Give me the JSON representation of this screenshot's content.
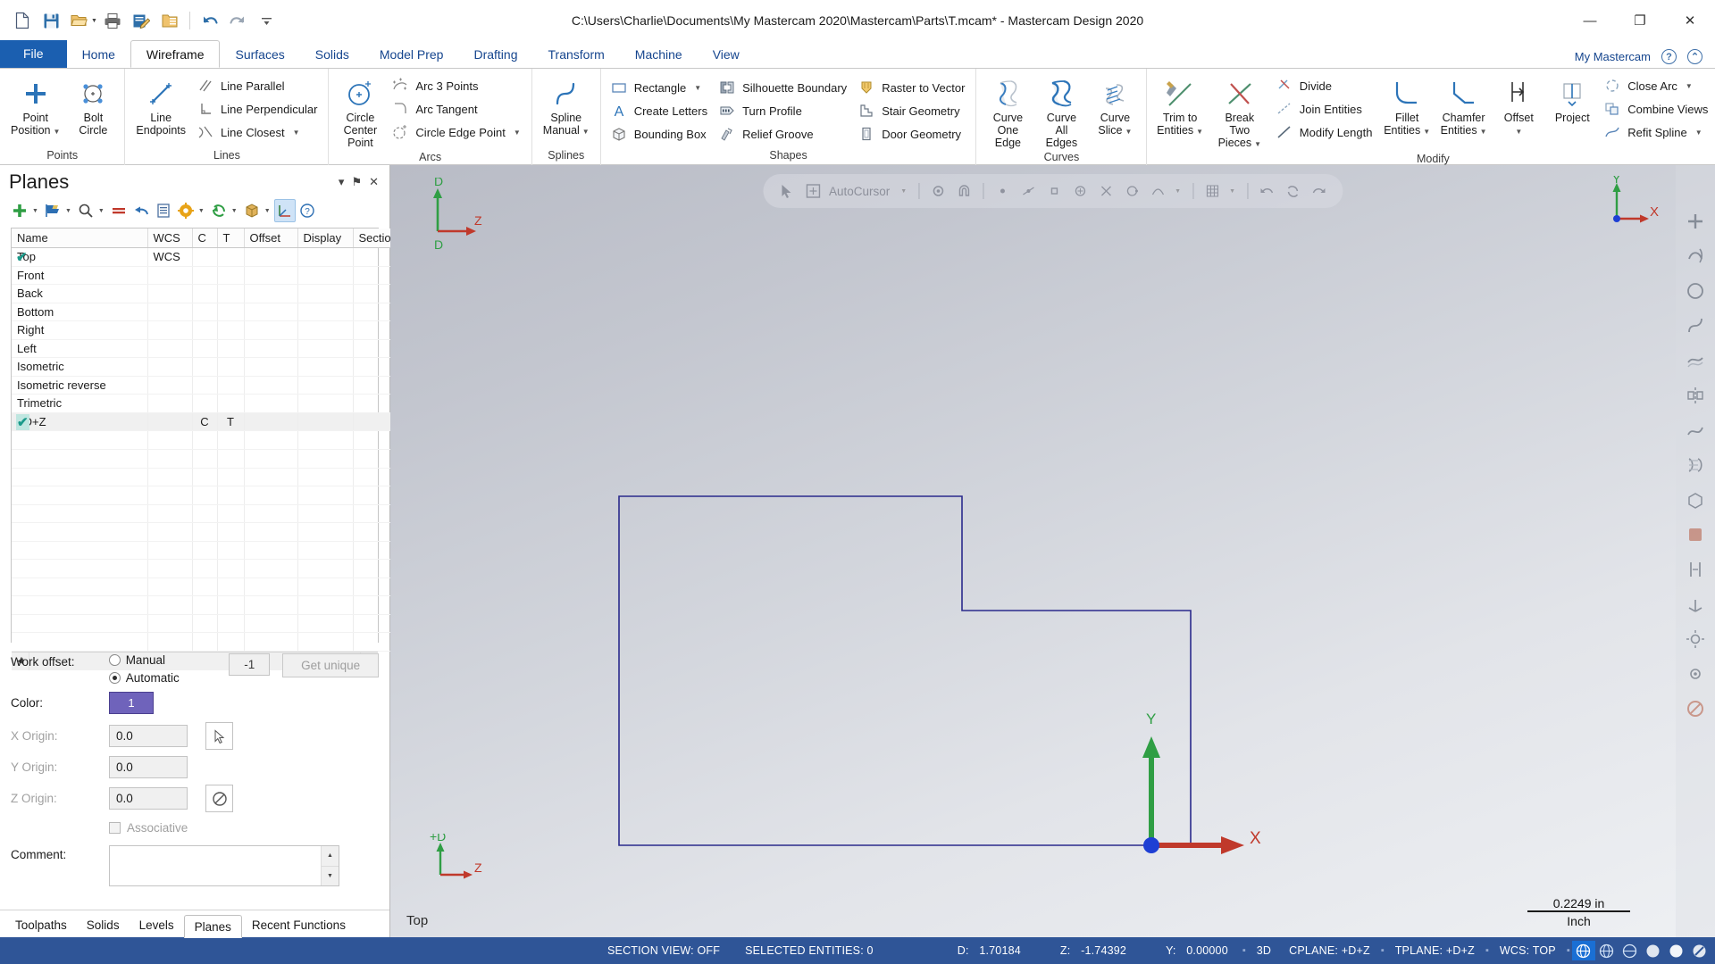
{
  "window": {
    "title": "C:\\Users\\Charlie\\Documents\\My Mastercam 2020\\Mastercam\\Parts\\T.mcam* - Mastercam Design 2020",
    "minimize": "—",
    "maximize": "❐",
    "close": "✕"
  },
  "quick_access": [
    {
      "name": "new-file-icon",
      "label": "New"
    },
    {
      "name": "save-icon",
      "label": "Save"
    },
    {
      "name": "open-folder-icon",
      "label": "Open"
    },
    {
      "name": "print-icon",
      "label": "Print"
    },
    {
      "name": "edit-file-icon",
      "label": "Edit"
    },
    {
      "name": "folder-list-icon",
      "label": "Browse"
    },
    {
      "name": "undo-icon",
      "label": "Undo"
    },
    {
      "name": "redo-icon",
      "label": "Redo"
    },
    {
      "name": "customize-qat-icon",
      "label": "Customize Quick Access Toolbar"
    }
  ],
  "tabs": [
    {
      "label": "File",
      "kind": "file"
    },
    {
      "label": "Home",
      "kind": "normal"
    },
    {
      "label": "Wireframe",
      "kind": "active"
    },
    {
      "label": "Surfaces",
      "kind": "normal"
    },
    {
      "label": "Solids",
      "kind": "normal"
    },
    {
      "label": "Model Prep",
      "kind": "normal"
    },
    {
      "label": "Drafting",
      "kind": "normal"
    },
    {
      "label": "Transform",
      "kind": "normal"
    },
    {
      "label": "Machine",
      "kind": "normal"
    },
    {
      "label": "View",
      "kind": "normal"
    }
  ],
  "tabstrip_right": {
    "account": "My Mastercam",
    "help": "?",
    "minimize_ribbon": "⌃"
  },
  "ribbon": {
    "groups": [
      {
        "title": "Points",
        "big": [
          {
            "label": "Point\nPosition",
            "icon": "point-position-icon",
            "caret": true
          },
          {
            "label": "Bolt\nCircle",
            "icon": "bolt-circle-icon",
            "caret": false
          }
        ],
        "small": []
      },
      {
        "title": "Lines",
        "big": [
          {
            "label": "Line\nEndpoints",
            "icon": "line-endpoints-icon",
            "caret": false
          }
        ],
        "small": [
          {
            "label": "Line Parallel",
            "icon": "line-parallel-icon",
            "caret": false
          },
          {
            "label": "Line Perpendicular",
            "icon": "line-perpendicular-icon",
            "caret": false
          },
          {
            "label": "Line Closest",
            "icon": "line-closest-icon",
            "caret": true
          }
        ]
      },
      {
        "title": "Arcs",
        "big": [
          {
            "label": "Circle\nCenter Point",
            "icon": "circle-center-point-icon",
            "caret": false
          }
        ],
        "small": [
          {
            "label": "Arc 3 Points",
            "icon": "arc-3-points-icon",
            "caret": false
          },
          {
            "label": "Arc Tangent",
            "icon": "arc-tangent-icon",
            "caret": false
          },
          {
            "label": "Circle Edge Point",
            "icon": "circle-edge-point-icon",
            "caret": true
          }
        ]
      },
      {
        "title": "Splines",
        "big": [
          {
            "label": "Spline\nManual",
            "icon": "spline-manual-icon",
            "caret": true
          }
        ],
        "small": []
      },
      {
        "title": "Shapes",
        "big": [],
        "small": [
          {
            "label": "Rectangle",
            "icon": "rectangle-icon",
            "caret": true
          },
          {
            "label": "Create Letters",
            "icon": "create-letters-icon",
            "caret": false
          },
          {
            "label": "Bounding Box",
            "icon": "bounding-box-icon",
            "caret": false
          }
        ],
        "small2": [
          {
            "label": "Silhouette Boundary",
            "icon": "silhouette-boundary-icon",
            "caret": false
          },
          {
            "label": "Turn Profile",
            "icon": "turn-profile-icon",
            "caret": false
          },
          {
            "label": "Relief Groove",
            "icon": "relief-groove-icon",
            "caret": false
          }
        ],
        "small3": [
          {
            "label": "Raster to Vector",
            "icon": "raster-to-vector-icon",
            "caret": false
          },
          {
            "label": "Stair Geometry",
            "icon": "stair-geometry-icon",
            "caret": false
          },
          {
            "label": "Door Geometry",
            "icon": "door-geometry-icon",
            "caret": false
          }
        ]
      },
      {
        "title": "Curves",
        "big": [
          {
            "label": "Curve\nOne Edge",
            "icon": "curve-one-edge-icon",
            "caret": false
          },
          {
            "label": "Curve All\nEdges",
            "icon": "curve-all-edges-icon",
            "caret": false
          },
          {
            "label": "Curve\nSlice",
            "icon": "curve-slice-icon",
            "caret": true
          }
        ],
        "small": []
      },
      {
        "title": "Modify",
        "big": [
          {
            "label": "Trim to\nEntities",
            "icon": "trim-to-entities-icon",
            "caret": true
          },
          {
            "label": "Break Two\nPieces",
            "icon": "break-two-pieces-icon",
            "caret": true
          }
        ],
        "small": [
          {
            "label": "Divide",
            "icon": "divide-icon",
            "caret": false
          },
          {
            "label": "Join Entities",
            "icon": "join-entities-icon",
            "caret": false
          },
          {
            "label": "Modify Length",
            "icon": "modify-length-icon",
            "caret": false
          }
        ],
        "big2": [
          {
            "label": "Fillet\nEntities",
            "icon": "fillet-entities-icon",
            "caret": true
          },
          {
            "label": "Chamfer\nEntities",
            "icon": "chamfer-entities-icon",
            "caret": true
          },
          {
            "label": "Offset",
            "icon": "offset-icon",
            "caret": true
          },
          {
            "label": "Project",
            "icon": "project-icon",
            "caret": false
          }
        ],
        "small2": [
          {
            "label": "Close Arc",
            "icon": "close-arc-icon",
            "caret": true
          },
          {
            "label": "Combine Views",
            "icon": "combine-views-icon",
            "caret": false
          },
          {
            "label": "Refit Spline",
            "icon": "refit-spline-icon",
            "caret": true
          }
        ]
      }
    ]
  },
  "planes": {
    "title": "Planes",
    "header_buttons": [
      {
        "name": "dropdown-arrow-icon",
        "glyph": "▾"
      },
      {
        "name": "pin-icon",
        "glyph": "⚑"
      },
      {
        "name": "close-icon",
        "glyph": "✕"
      }
    ],
    "toolbar": [
      {
        "name": "add-plane-icon",
        "caret": true
      },
      {
        "name": "flag-plane-icon",
        "caret": true
      },
      {
        "name": "find-plane-icon",
        "caret": true
      },
      {
        "name": "delete-plane-icon",
        "caret": false
      },
      {
        "name": "undo-plane-icon",
        "caret": false
      },
      {
        "name": "list-view-icon",
        "caret": false
      },
      {
        "name": "settings-gear-icon",
        "caret": true
      },
      {
        "name": "refresh-plane-icon",
        "caret": true
      },
      {
        "name": "solid-plane-icon",
        "caret": true
      },
      {
        "name": "axis-display-icon",
        "caret": false
      },
      {
        "name": "help-icon",
        "caret": false
      }
    ],
    "columns": [
      "Name",
      "WCS",
      "C",
      "T",
      "Offset",
      "Display",
      "Section"
    ],
    "rows": [
      {
        "name": "Top",
        "checked": true,
        "wcs": "WCS",
        "c": "",
        "t": "",
        "offset": "",
        "display": "",
        "section": "",
        "selected": false
      },
      {
        "name": "Front",
        "checked": false,
        "wcs": "",
        "c": "",
        "t": "",
        "offset": "",
        "display": "",
        "section": "",
        "selected": false
      },
      {
        "name": "Back",
        "checked": false,
        "wcs": "",
        "c": "",
        "t": "",
        "offset": "",
        "display": "",
        "section": "",
        "selected": false
      },
      {
        "name": "Bottom",
        "checked": false,
        "wcs": "",
        "c": "",
        "t": "",
        "offset": "",
        "display": "",
        "section": "",
        "selected": false
      },
      {
        "name": "Right",
        "checked": false,
        "wcs": "",
        "c": "",
        "t": "",
        "offset": "",
        "display": "",
        "section": "",
        "selected": false
      },
      {
        "name": "Left",
        "checked": false,
        "wcs": "",
        "c": "",
        "t": "",
        "offset": "",
        "display": "",
        "section": "",
        "selected": false
      },
      {
        "name": "Isometric",
        "checked": false,
        "wcs": "",
        "c": "",
        "t": "",
        "offset": "",
        "display": "",
        "section": "",
        "selected": false
      },
      {
        "name": "Isometric reverse",
        "checked": false,
        "wcs": "",
        "c": "",
        "t": "",
        "offset": "",
        "display": "",
        "section": "",
        "selected": false
      },
      {
        "name": "Trimetric",
        "checked": false,
        "wcs": "",
        "c": "",
        "t": "",
        "offset": "",
        "display": "",
        "section": "",
        "selected": false
      },
      {
        "name": "+D+Z",
        "checked": true,
        "wcs": "",
        "c": "C",
        "t": "T",
        "offset": "",
        "display": "",
        "section": "",
        "selected": true
      }
    ],
    "form": {
      "work_offset_label": "Work offset:",
      "manual_label": "Manual",
      "automatic_label": "Automatic",
      "manual_selected": false,
      "automatic_selected": true,
      "offset_value": "-1",
      "get_unique_label": "Get unique",
      "color_label": "Color:",
      "color_value": "1",
      "color_hex": "#6f63bb",
      "x_origin_label": "X Origin:",
      "x_origin_value": "0.0",
      "y_origin_label": "Y Origin:",
      "y_origin_value": "0.0",
      "z_origin_label": "Z Origin:",
      "z_origin_value": "0.0",
      "associative_label": "Associative",
      "associative_checked": false,
      "comment_label": "Comment:",
      "comment_value": ""
    },
    "bottom_tabs": [
      {
        "label": "Toolpaths",
        "active": false
      },
      {
        "label": "Solids",
        "active": false
      },
      {
        "label": "Levels",
        "active": false
      },
      {
        "label": "Planes",
        "active": true
      },
      {
        "label": "Recent Functions",
        "active": false
      }
    ]
  },
  "viewport": {
    "autocursor_label": "AutoCursor",
    "view_name": "Top",
    "scale_value": "0.2249 in",
    "scale_unit": "Inch",
    "gnomon_top_left": {
      "d": "D",
      "z": "Z",
      "d2": "D"
    },
    "gnomon_bottom_left": {
      "d": "+D",
      "z": "Z"
    },
    "gnomon_top_right": {
      "y": "Y",
      "x": "X"
    },
    "origin_axes": {
      "x": "X",
      "y": "Y"
    },
    "geometry_color": "#2a2a8c"
  },
  "status": {
    "section_view": "SECTION VIEW: OFF",
    "selected_entities": "SELECTED ENTITIES: 0",
    "d_label": "D:",
    "d_value": "1.70184",
    "z_label": "Z:",
    "z_value": "-1.74392",
    "y_label": "Y:",
    "y_value": "0.00000",
    "dimension_mode": "3D",
    "cplane": "CPLANE: +D+Z",
    "tplane": "TPLANE: +D+Z",
    "wcs": "WCS: TOP",
    "icons": [
      {
        "name": "globe-shaded-icon",
        "active": true
      },
      {
        "name": "globe-wire-icon",
        "active": false
      },
      {
        "name": "globe-half-icon",
        "active": false
      },
      {
        "name": "sphere-light-icon",
        "active": false
      },
      {
        "name": "sphere-solid-icon",
        "active": false
      },
      {
        "name": "sphere-slash-icon",
        "active": false
      },
      {
        "name": "resize-grip-icon",
        "active": false
      }
    ]
  }
}
